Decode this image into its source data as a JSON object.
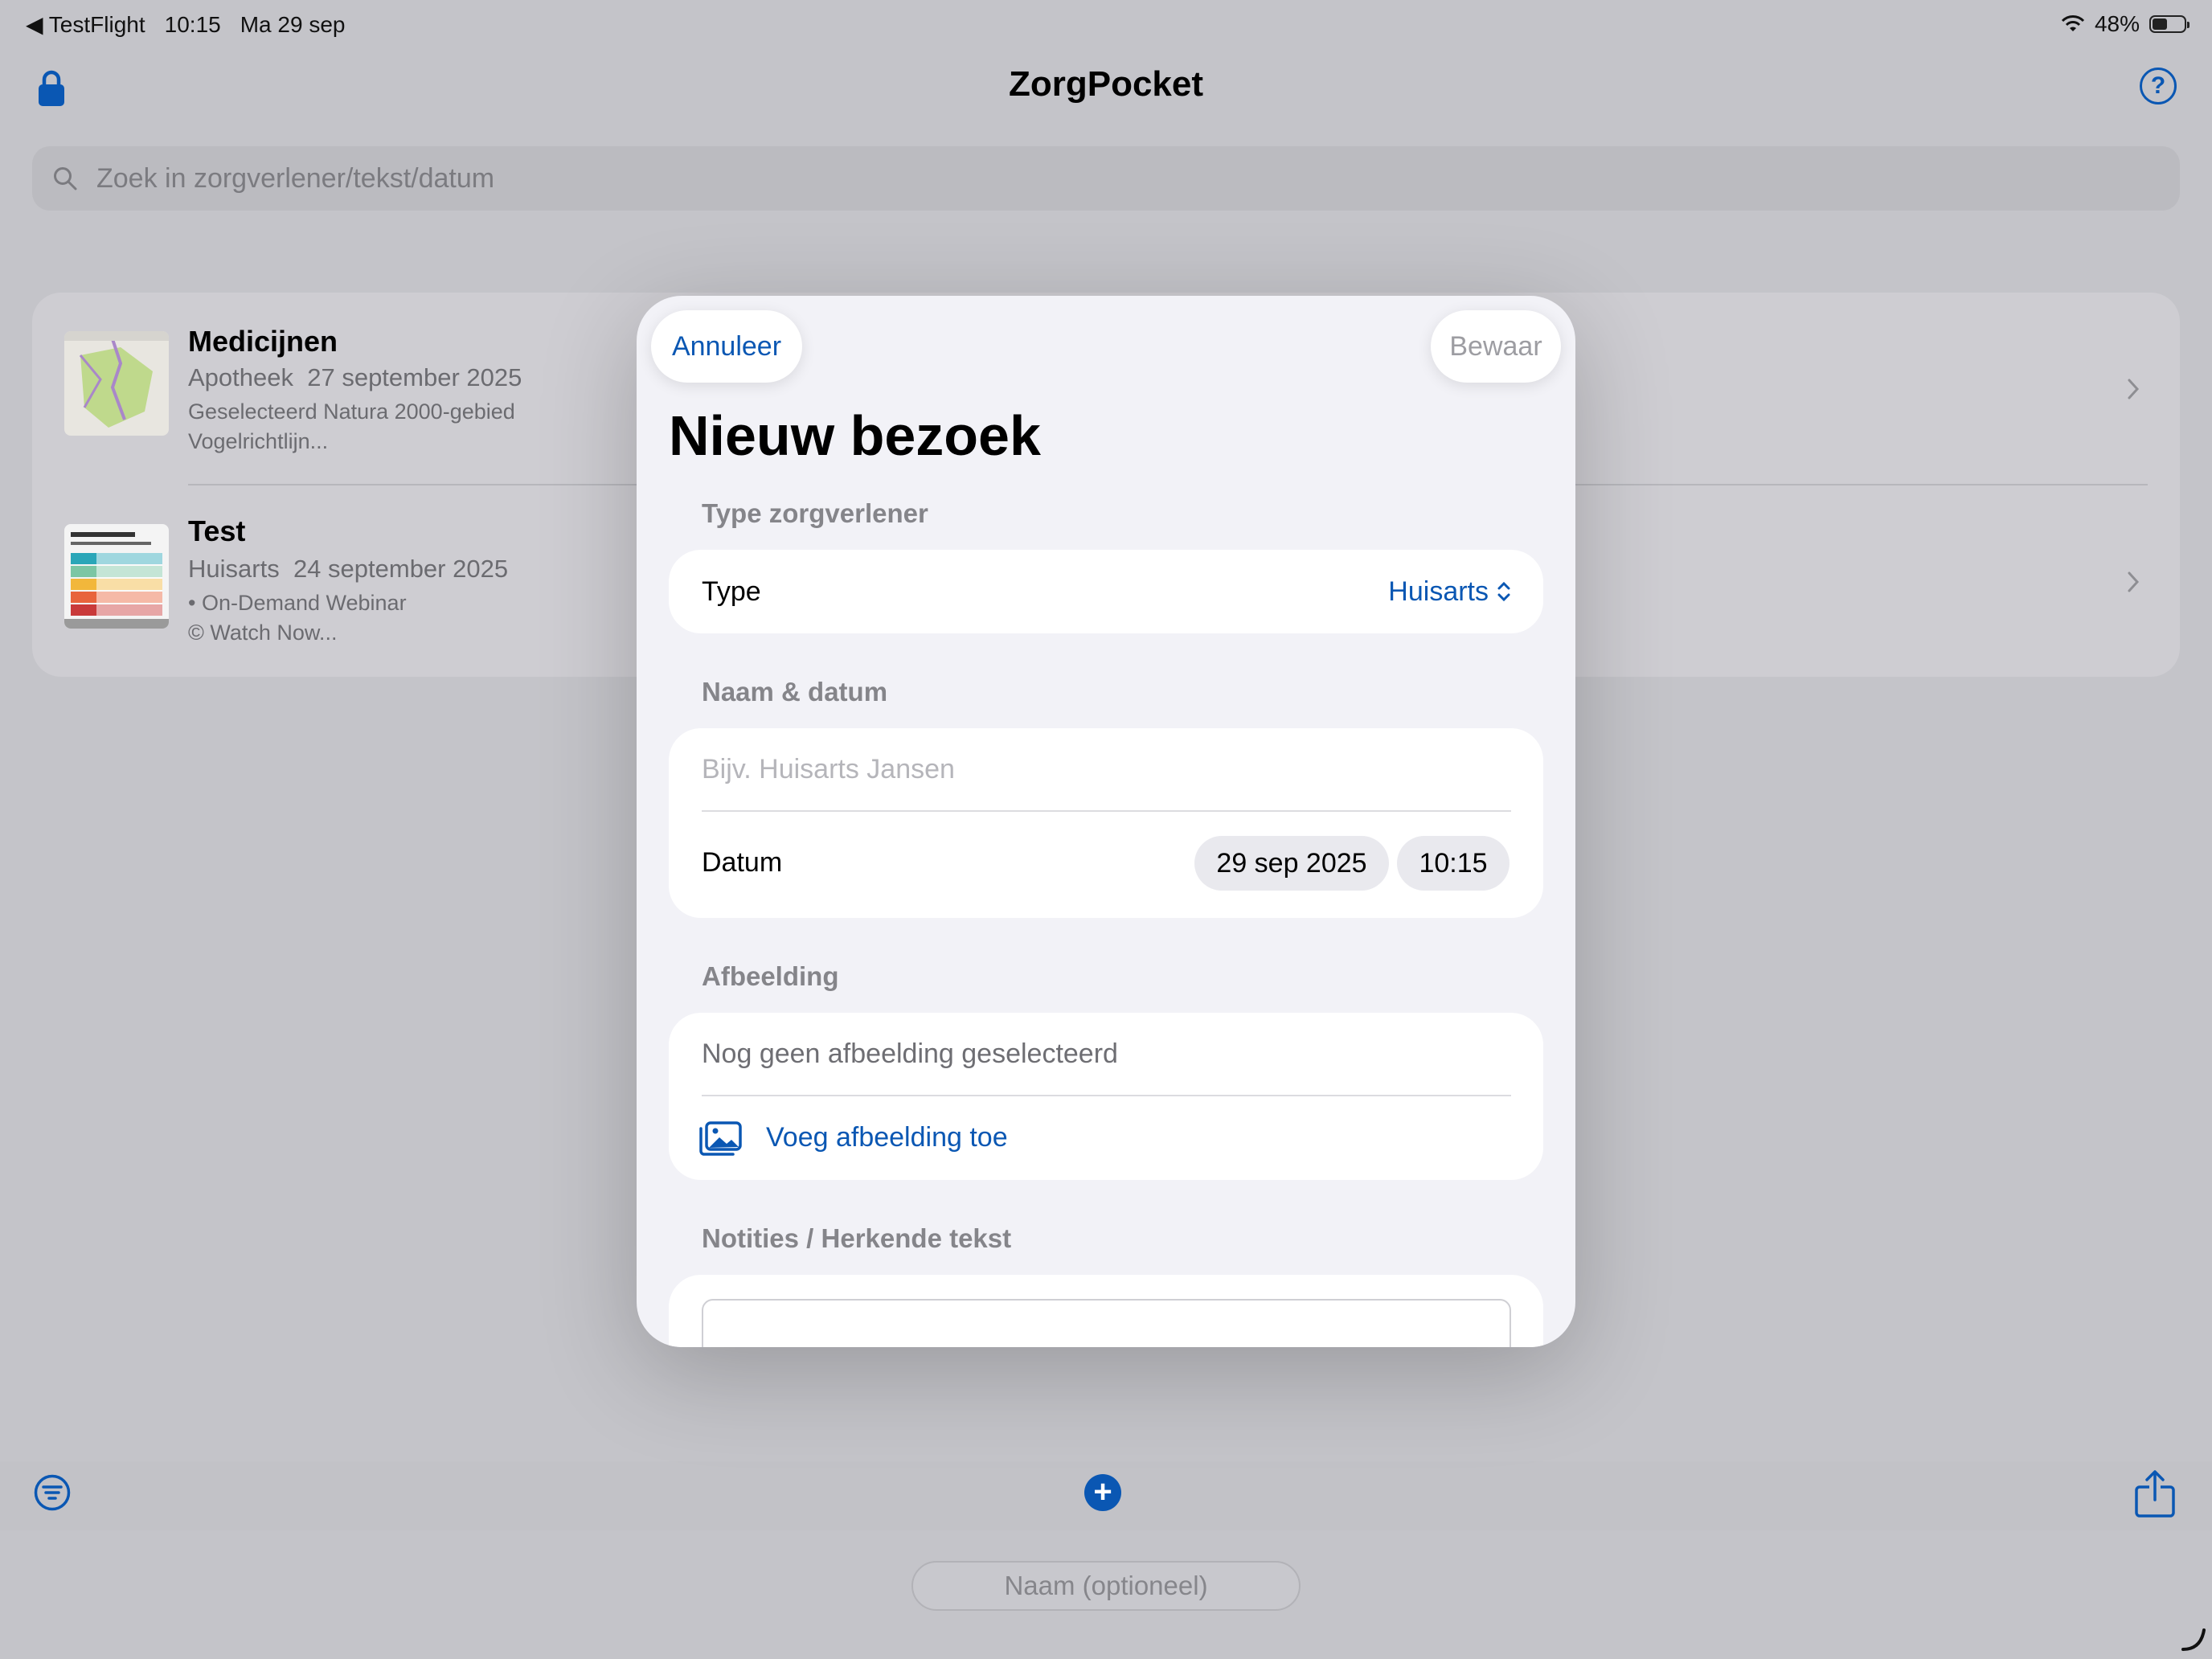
{
  "status_bar": {
    "back_app": "◀ TestFlight",
    "time": "10:15",
    "date": "Ma 29 sep",
    "battery": "48%",
    "battery_level": 0.48
  },
  "header": {
    "title": "ZorgPocket",
    "lock_icon": "lock-icon",
    "help_icon": "question-circle-icon",
    "help_label": "?"
  },
  "search": {
    "placeholder": "Zoek in zorgverlener/tekst/datum"
  },
  "visits": [
    {
      "title": "Medicijnen",
      "provider": "Apotheek",
      "date": "27 september 2025",
      "snippet_1": "Geselecteerd Natura 2000-gebied",
      "snippet_2": "Vogelrichtlijn..."
    },
    {
      "title": "Test",
      "provider": "Huisarts",
      "date": "24 september 2025",
      "snippet_1": "• On-Demand Webinar",
      "snippet_2": "© Watch Now..."
    }
  ],
  "toolbar": {
    "filter_icon": "filter-icon",
    "add_icon": "plus-circle-icon",
    "add_label": "+",
    "share_icon": "share-icon",
    "name_placeholder": "Naam (optioneel)"
  },
  "modal": {
    "cancel_label": "Annuleer",
    "save_label": "Bewaar",
    "title": "Nieuw bezoek",
    "section_type": "Type zorgverlener",
    "type_label": "Type",
    "type_value": "Huisarts",
    "section_name_date": "Naam & datum",
    "name_placeholder": "Bijv. Huisarts Jansen",
    "date_label": "Datum",
    "date_value": "29 sep 2025",
    "time_value": "10:15",
    "section_image": "Afbeelding",
    "no_image_text": "Nog geen afbeelding geselecteerd",
    "add_image_label": "Voeg afbeelding toe",
    "section_notes": "Notities / Herkende tekst"
  },
  "colors": {
    "accent": "#0a57b3",
    "background": "#c4c4c9",
    "sheet": "#f2f2f7"
  }
}
